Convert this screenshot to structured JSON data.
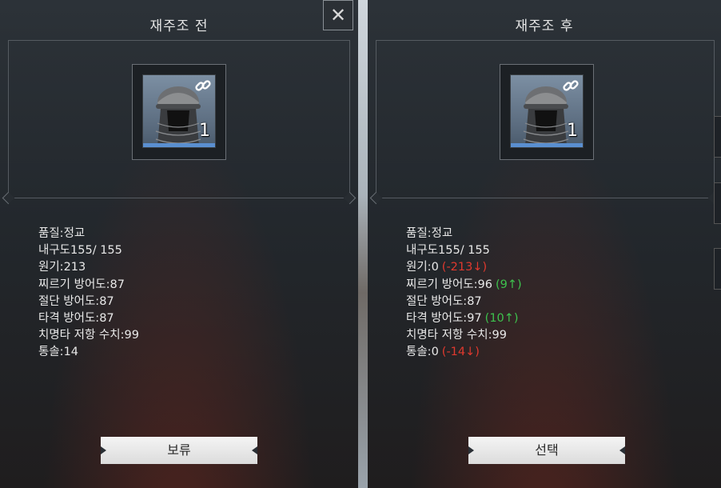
{
  "left_panel": {
    "title": "재주조 전",
    "item_count": "1",
    "stats": {
      "quality": "품질:정교",
      "durability": "내구도155/ 155",
      "energy": "원기:213",
      "pierce_defense": "찌르기 방어도:87",
      "slash_defense": "절단 방어도:87",
      "blunt_defense": "타격 방어도:87",
      "crit_resist": "치명타 저항 수치:99",
      "command": "통솔:14"
    },
    "button_label": "보류"
  },
  "right_panel": {
    "title": "재주조 후",
    "item_count": "1",
    "stats": {
      "quality": "품질:정교",
      "durability": "내구도155/ 155",
      "energy": "원기:0",
      "energy_delta": "(-213↓)",
      "pierce_defense": "찌르기 방어도:96",
      "pierce_delta": "(9↑)",
      "slash_defense": "절단 방어도:87",
      "blunt_defense": "타격 방어도:97",
      "blunt_delta": "(10↑)",
      "crit_resist": "치명타 저항 수치:99",
      "command": "통솔:0",
      "command_delta": "(-14↓)"
    },
    "button_label": "선택"
  },
  "close": {
    "icon": "close-icon",
    "glyph": "✕"
  },
  "colors": {
    "delta_down": "#e0392e",
    "delta_up": "#3ec24d"
  }
}
